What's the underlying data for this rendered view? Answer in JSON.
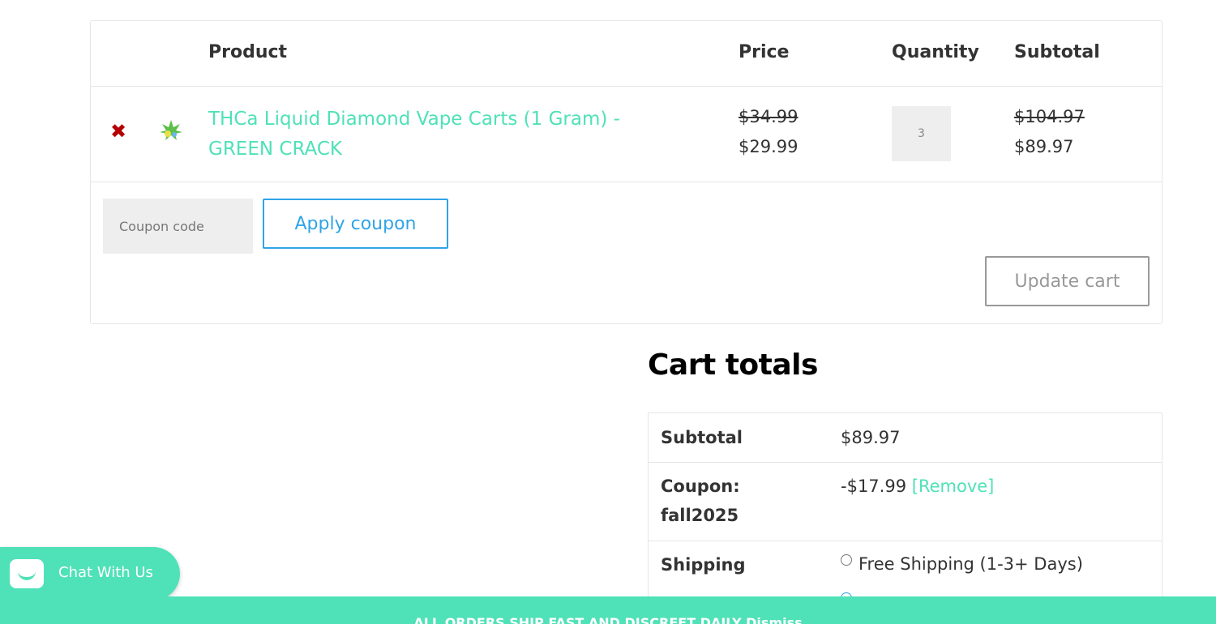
{
  "cart": {
    "headers": {
      "product": "Product",
      "price": "Price",
      "quantity": "Quantity",
      "subtotal": "Subtotal"
    },
    "items": [
      {
        "remove_symbol": "✖",
        "thumbnail_icon": "cannabis-leaf-icon",
        "name": "THCa Liquid Diamond Vape Carts (1 Gram) - GREEN CRACK",
        "price_original": "$34.99",
        "price_sale": "$29.99",
        "quantity": "3",
        "subtotal_original": "$104.97",
        "subtotal_sale": "$89.97"
      }
    ],
    "coupon_placeholder": "Coupon code",
    "apply_coupon_label": "Apply coupon",
    "update_cart_label": "Update cart"
  },
  "totals": {
    "title": "Cart totals",
    "subtotal_label": "Subtotal",
    "subtotal_value": "$89.97",
    "coupon_label_line1": "Coupon:",
    "coupon_label_line2": "fall2025",
    "coupon_value": "-$17.99",
    "coupon_remove": "[Remove]",
    "shipping_label": "Shipping",
    "shipping_option_1": "Free Shipping (1-3+ Days)"
  },
  "chat": {
    "label": "Chat With Us"
  },
  "promo": {
    "text": "ALL ORDERS SHIP FAST AND DISCREET DAILY Dismiss"
  },
  "colors": {
    "accent": "#4fe1b7",
    "link_blue": "#2fa4e7",
    "remove_red": "#b40000"
  }
}
